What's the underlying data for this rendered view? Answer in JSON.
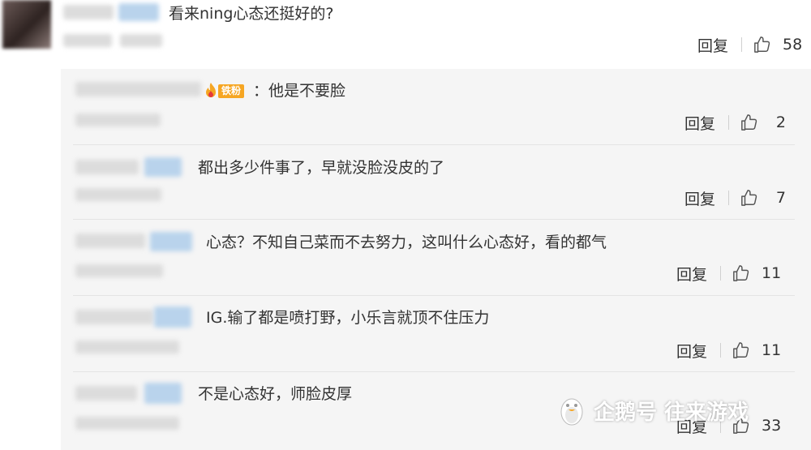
{
  "top_comment": {
    "text": "看来ning心态还挺好的?",
    "reply_label": "回复",
    "likes": "58"
  },
  "replies": [
    {
      "text": "他是不要脸",
      "reply_label": "回复",
      "likes": "2",
      "badge": "铁粉"
    },
    {
      "text": "都出多少件事了，早就没脸没皮的了",
      "reply_label": "回复",
      "likes": "7"
    },
    {
      "text": "心态？不知自己菜而不去努力，这叫什么心态好，看的都气",
      "reply_label": "回复",
      "likes": "11"
    },
    {
      "text": "IG.输了都是喷打野，小乐言就顶不住压力",
      "reply_label": "回复",
      "likes": "11"
    },
    {
      "text": "不是心态好，师脸皮厚",
      "reply_label": "回复",
      "likes": "33"
    }
  ],
  "watermark": "企鹅号 往来游戏",
  "icons": {
    "like": "thumbs-up-icon",
    "badge": "fire-icon",
    "watermark": "penguin-icon"
  },
  "colors": {
    "reply_bg": "#f5f5f5",
    "badge": "#f6a623",
    "blurred_name": "#b9d3ec"
  }
}
